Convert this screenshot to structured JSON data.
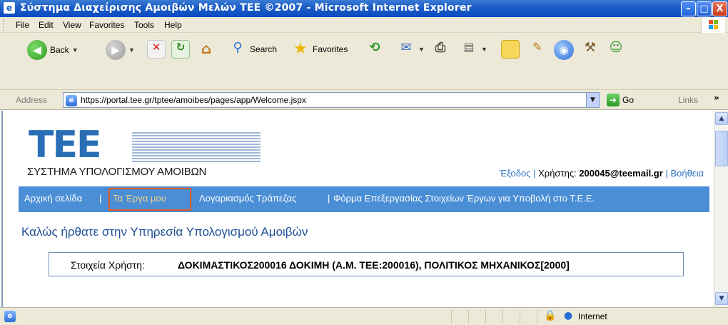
{
  "window": {
    "title": "Σύστημα Διαχείρισης Αμοιβών Μελών ΤΕΕ ©2007 - Microsoft Internet Explorer",
    "min_label": "–",
    "max_label": "□",
    "close_label": "X"
  },
  "menubar": {
    "items": [
      "File",
      "Edit",
      "View",
      "Favorites",
      "Tools",
      "Help"
    ]
  },
  "toolbar": {
    "back_label": "Back",
    "search_label": "Search",
    "favorites_label": "Favorites"
  },
  "addressbar": {
    "label": "Address",
    "url": "https://portal.tee.gr/tptee/amoibes/pages/app/Welcome.jspx",
    "go_label": "Go",
    "links_label": "Links"
  },
  "page": {
    "logo_text": "ΤΕΕ",
    "brand_subtitle": "ΣΥΣΤΗΜΑ ΥΠΟΛΟΓΙΣΜΟΥ ΑΜΟΙΒΩΝ",
    "exit_label": "Έξοδος",
    "user_prefix": "Χρήστης:",
    "user_email": "200045@teemail.gr",
    "help_label": "Βοήθεια",
    "nav": {
      "home": "Αρχική σελίδα",
      "my_works": "Τα Έργα μου",
      "bank_account": "Λογαριασμός Τράπεζας",
      "submission_form": "Φόρμα Επεξεργασίας Στοιχείων Έργων για Υποβολή στο Τ.Ε.Ε."
    },
    "welcome_heading": "Καλώς ήρθατε στην Υπηρεσία Υπολογισμού Αμοιβών",
    "user_info_label": "Στοιχεία Χρήστη:",
    "user_info_value": "ΔΟΚΙΜΑΣΤΙΚΟΣ200016 ΔΟΚΙΜΗ (Α.Μ. ΤΕΕ:200016), ΠΟΛΙΤΙΚΟΣ ΜΗΧΑΝΙΚΟΣ[2000]"
  },
  "statusbar": {
    "zone": "Internet"
  },
  "colors": {
    "nav_bg": "#4a8ed6",
    "logo_blue": "#2a6fb6",
    "link_blue": "#2f74c2",
    "highlight_border": "#e05a20"
  }
}
